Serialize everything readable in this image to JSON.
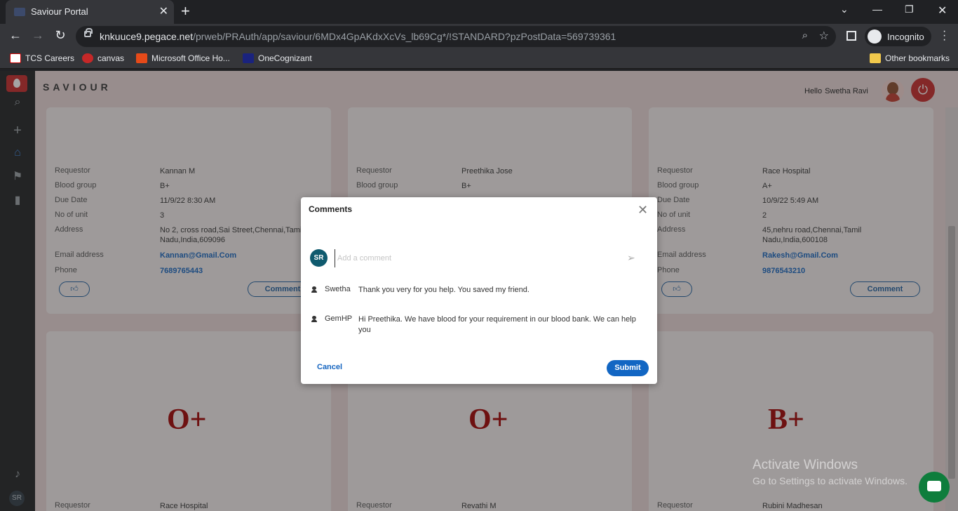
{
  "browser": {
    "tab_title": "Saviour Portal",
    "url_host": "knkuuce9.pegace.net",
    "url_path": "/prweb/PRAuth/app/saviour/6MDx4GpAKdxXcVs_lb69Cg*/!STANDARD?pzPostData=569739361",
    "incognito_label": "Incognito",
    "bookmarks": [
      "TCS Careers",
      "canvas",
      "Microsoft Office Ho...",
      "OneCognizant"
    ],
    "other_bookmarks": "Other bookmarks"
  },
  "app": {
    "brand": "SAVIOUR",
    "greeting": "Hello",
    "user_name": "Swetha Ravi",
    "nav_avatar": "SR"
  },
  "labels": {
    "requestor": "Requestor",
    "blood_group": "Blood group",
    "due_date": "Due Date",
    "no_of_unit": "No of unit",
    "address": "Address",
    "email": "Email address",
    "phone": "Phone",
    "comment": "Comment"
  },
  "cards_top": [
    {
      "requestor": "Kannan M",
      "blood_group": "B+",
      "due_date": "11/9/22 8:30 AM",
      "units": "3",
      "address": "No 2, cross road,Sai Street,Chennai,Tamil Nadu,India,609096",
      "email": "Kannan@Gmail.Com",
      "phone": "7689765443"
    },
    {
      "requestor": "Preethika Jose",
      "blood_group": "B+",
      "due_date": "",
      "units": "",
      "address": "",
      "email": "",
      "phone": ""
    },
    {
      "requestor": "Race Hospital",
      "blood_group": "A+",
      "due_date": "10/9/22 5:49 AM",
      "units": "2",
      "address": "45,nehru road,Chennai,Tamil Nadu,India,600108",
      "email": "Rakesh@Gmail.Com",
      "phone": "9876543210"
    }
  ],
  "cards_bottom": [
    {
      "group": "O+",
      "requestor": "Race Hospital"
    },
    {
      "group": "O+",
      "requestor": "Revathi M"
    },
    {
      "group": "B+",
      "requestor": "Rubini Madhesan"
    }
  ],
  "modal": {
    "title": "Comments",
    "avatar": "SR",
    "input_placeholder": "Add a comment",
    "comments": [
      {
        "author": "Swetha",
        "text": "Thank you very for you help. You saved my friend."
      },
      {
        "author": "GemHP",
        "text": "Hi Preethika. We have blood for your requirement in our blood bank. We can help you"
      }
    ],
    "cancel_label": "Cancel",
    "submit_label": "Submit"
  },
  "watermark": {
    "line1": "Activate Windows",
    "line2": "Go to Settings to activate Windows."
  }
}
